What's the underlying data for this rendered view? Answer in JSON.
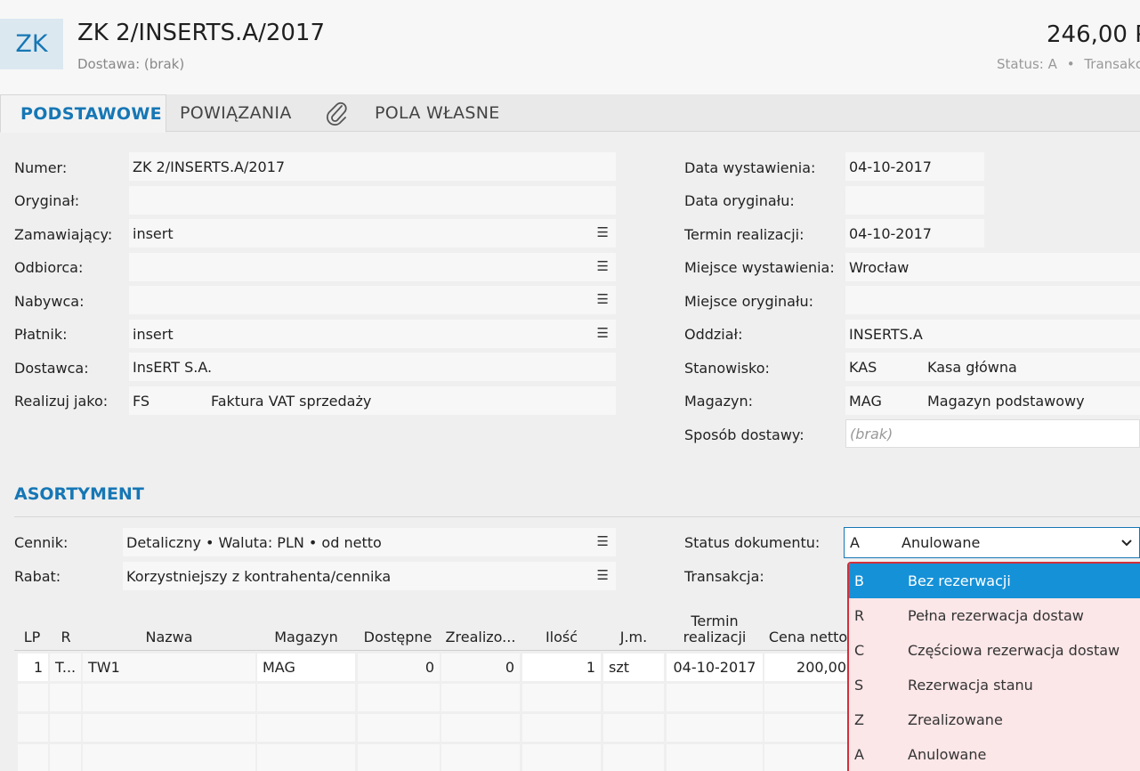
{
  "header": {
    "avatar": "ZK",
    "title": "ZK 2/INSERTS.A/2017",
    "subtitle": "Dostawa: (brak)",
    "amount": "246,00 P",
    "status_label": "Status:",
    "status_value": "A",
    "transaction_label": "Transakc"
  },
  "tabs": [
    {
      "label": "PODSTAWOWE"
    },
    {
      "label": "POWIĄZANIA"
    },
    {
      "label": "POLA WŁASNE"
    }
  ],
  "left_form": {
    "numer": {
      "label": "Numer:",
      "value": "ZK 2/INSERTS.A/2017"
    },
    "oryginal": {
      "label": "Oryginał:",
      "value": ""
    },
    "zamawiajacy": {
      "label": "Zamawiający:",
      "value": "insert"
    },
    "odbiorca": {
      "label": "Odbiorca:",
      "value": ""
    },
    "nabywca": {
      "label": "Nabywca:",
      "value": ""
    },
    "platnik": {
      "label": "Płatnik:",
      "value": "insert"
    },
    "dostawca": {
      "label": "Dostawca:",
      "value": "InsERT S.A."
    },
    "realizuj": {
      "label": "Realizuj jako:",
      "code": "FS",
      "value": "Faktura VAT sprzedaży"
    }
  },
  "right_form": {
    "data_wyst": {
      "label": "Data wystawienia:",
      "value": "04-10-2017"
    },
    "data_oryg": {
      "label": "Data oryginału:",
      "value": ""
    },
    "termin": {
      "label": "Termin realizacji:",
      "value": "04-10-2017"
    },
    "miejsce_wyst": {
      "label": "Miejsce wystawienia:",
      "value": "Wrocław"
    },
    "miejsce_oryg": {
      "label": "Miejsce oryginału:",
      "value": ""
    },
    "oddzial": {
      "label": "Oddział:",
      "value": "INSERTS.A"
    },
    "stanowisko": {
      "label": "Stanowisko:",
      "code": "KAS",
      "value": "Kasa główna"
    },
    "magazyn": {
      "label": "Magazyn:",
      "code": "MAG",
      "value": "Magazyn podstawowy"
    },
    "sposob": {
      "label": "Sposób dostawy:",
      "placeholder": "(brak)"
    }
  },
  "asortyment": {
    "title": "ASORTYMENT",
    "cennik": {
      "label": "Cennik:",
      "value": "Detaliczny • Waluta: PLN • od netto"
    },
    "rabat": {
      "label": "Rabat:",
      "value": "Korzystniejszy z kontrahenta/cennika"
    },
    "status_dok": {
      "label": "Status dokumentu:",
      "code": "A",
      "value": "Anulowane"
    },
    "transakcja": {
      "label": "Transakcja:"
    }
  },
  "status_options": [
    {
      "code": "B",
      "label": "Bez rezerwacji",
      "selected": true
    },
    {
      "code": "R",
      "label": "Pełna rezerwacja dostaw"
    },
    {
      "code": "C",
      "label": "Częściowa rezerwacja dostaw"
    },
    {
      "code": "S",
      "label": "Rezerwacja stanu"
    },
    {
      "code": "Z",
      "label": "Zrealizowane"
    },
    {
      "code": "A",
      "label": "Anulowane"
    }
  ],
  "grid": {
    "columns": [
      "LP",
      "R",
      "Nazwa",
      "Magazyn",
      "Dostępne",
      "Zrealizo...",
      "Ilość",
      "J.m.",
      "Termin realizacji",
      "Cena netto"
    ],
    "rows": [
      {
        "lp": "1",
        "r": "T...",
        "nazwa": "TW1",
        "magazyn": "MAG",
        "dostepne": "0",
        "zrealizowane": "0",
        "ilosc": "1",
        "jm": "szt",
        "termin": "04-10-2017",
        "cena": "200,00"
      }
    ]
  },
  "icons": {
    "menu": "menu-lines-icon",
    "attachment": "paperclip-icon",
    "chevron": "chevron-down-icon"
  },
  "colors": {
    "accent": "#1677b5",
    "selection": "#1591d8",
    "dropdown_border": "#d32f3a"
  }
}
